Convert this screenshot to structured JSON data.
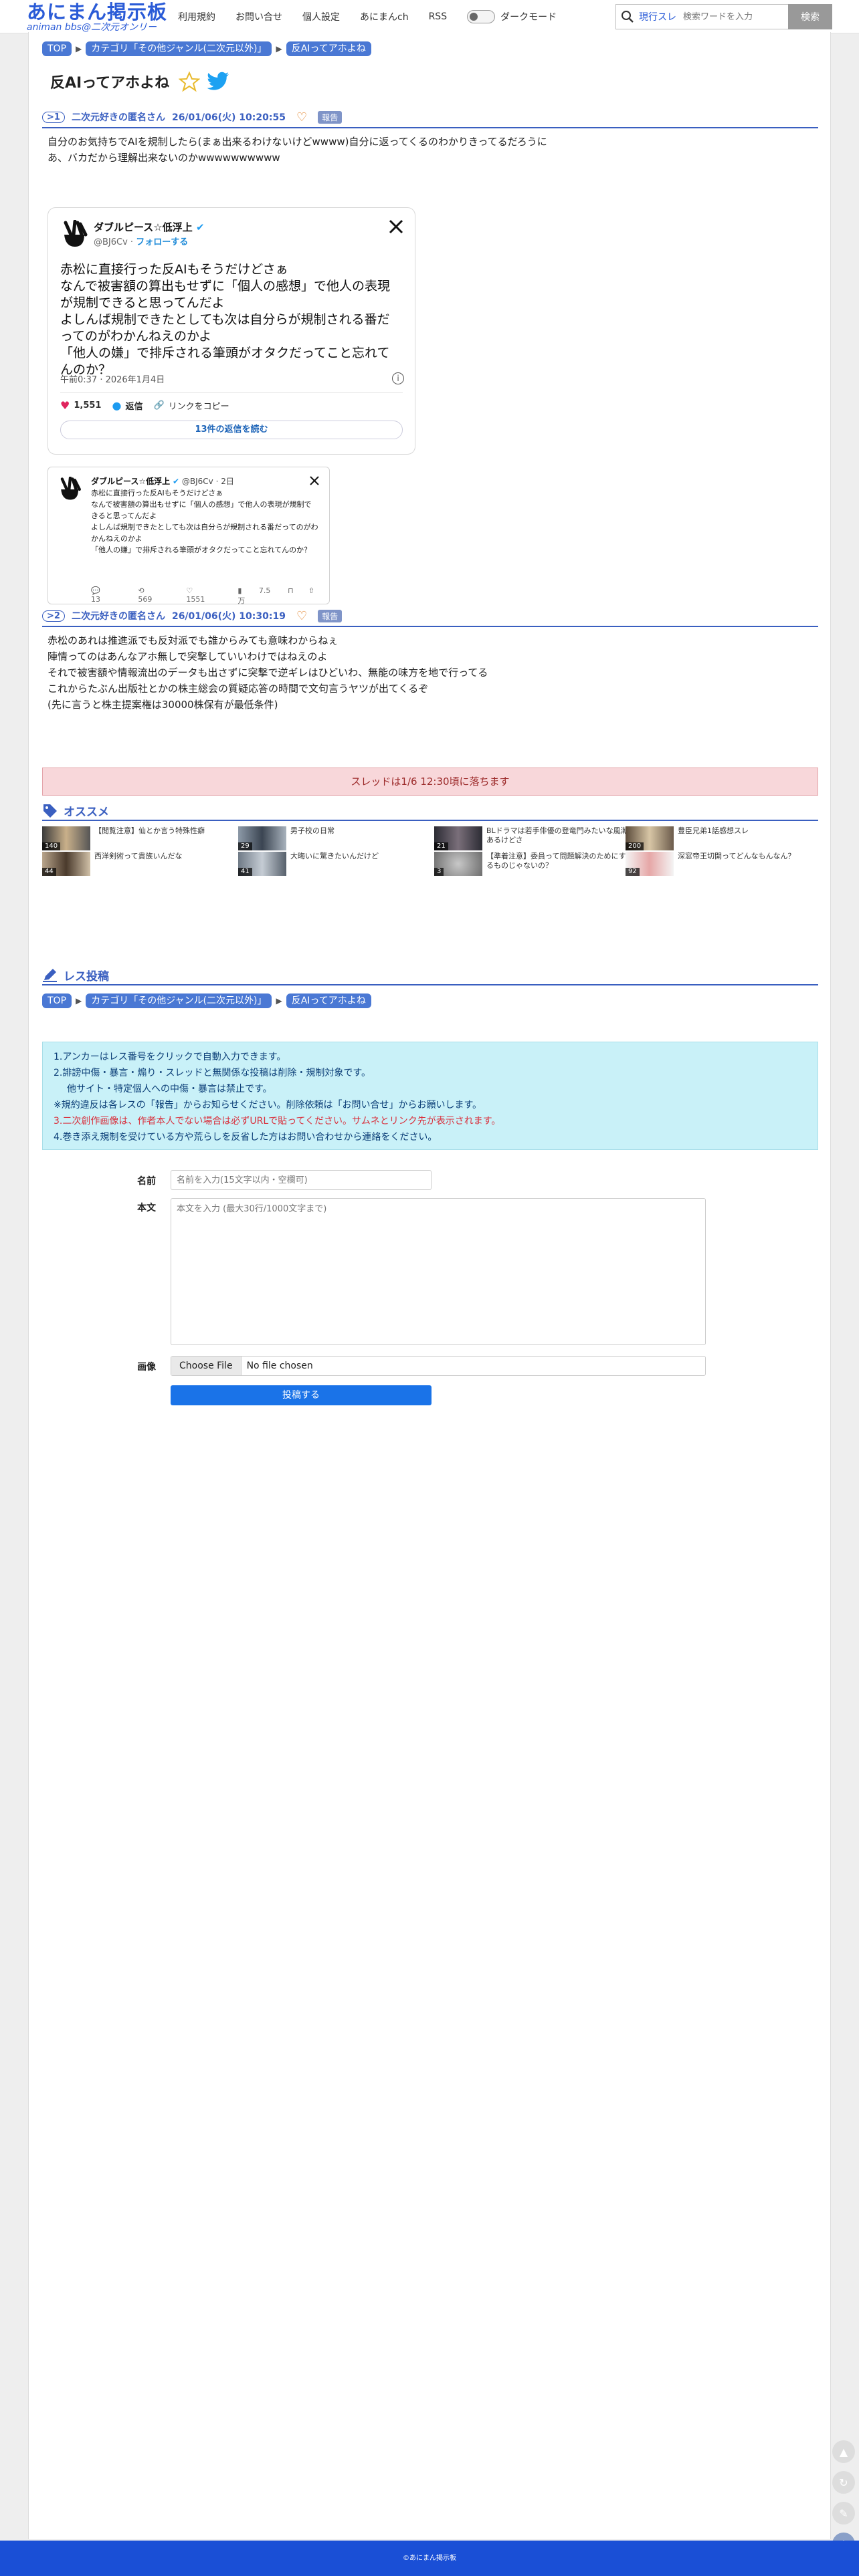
{
  "header": {
    "logo": "あにまん掲示板",
    "logo_sub": "animan bbs@二次元オンリー",
    "nav": [
      "利用規約",
      "お問い合せ",
      "個人設定",
      "あにまんch",
      "RSS"
    ],
    "dark_mode": "ダークモード",
    "search_link": "現行スレ",
    "search_placeholder": "検索ワードを入力",
    "search_button": "検索"
  },
  "breadcrumb": {
    "top": "TOP",
    "category": "カテゴリ「その他ジャンル(二次元以外)」",
    "thread": "反AIってアホよね"
  },
  "thread_title": "反AIってアホよね",
  "posts": [
    {
      "num": ">1",
      "name": "二次元好きの匿名さん",
      "date": "26/01/06(火) 10:20:55",
      "report": "報告",
      "body": [
        "自分のお気持ちでAIを規制したら(まぁ出来るわけないけどwwww)自分に返ってくるのわかりきってるだろうに",
        "あ、バカだから理解出来ないのかwwwwwwwwww"
      ]
    },
    {
      "num": ">2",
      "name": "二次元好きの匿名さん",
      "date": "26/01/06(火) 10:30:19",
      "report": "報告",
      "body": [
        "赤松のあれは推進派でも反対派でも誰からみても意味わからねぇ",
        "陣情ってのはあんなアホ無しで突撃していいわけではねえのよ",
        "それで被害額や情報流出のデータも出さずに突撃で逆ギレはひどいわ、無能の味方を地で行ってる",
        "これからたぶん出版社とかの株主総会の質疑応答の時間で文句言うヤツが出てくるぞ",
        "(先に言うと株主提案権は30000株保有が最低条件)"
      ]
    }
  ],
  "tweet": {
    "name": "ダブルピース☆低浮上",
    "handle": "@BJ6Cv",
    "follow": "フォローする",
    "text": [
      "赤松に直接行った反AIもそうだけどさぁ",
      "なんで被害額の算出もせずに「個人の感想」で他人の表現が規制できると思ってんだよ",
      "よしんば規制できたとしても次は自分らが規制される番だってのがわかんねえのかよ",
      "「他人の嫌」で排斥される筆頭がオタクだってこと忘れてんのか？"
    ],
    "time": "午前0:37 · 2026年1月4日",
    "likes": "1,551",
    "reply": "返信",
    "copy": "リンクをコピー",
    "replies_link": "13件の返信を読む"
  },
  "quote": {
    "name": "ダブルピース☆低浮上",
    "handle": "@BJ6Cv · 2日",
    "text": [
      "赤松に直接行った反AIもそうだけどさぁ",
      "なんで被害額の算出もせずに「個人の感想」で他人の表現が規制できると思ってんだよ",
      "よしんば規制できたとしても次は自分らが規制される番だってのがわかんねえのかよ",
      "「他人の嫌」で排斥される筆頭がオタクだってこと忘れてんのか？"
    ],
    "replies": "13",
    "retweets": "569",
    "likes": "1551",
    "views": "7.5万"
  },
  "notice": "スレッドは1/6 12:30頃に落ちます",
  "recommend_title": "オススメ",
  "recommend": [
    {
      "title": "【閲覧注意】仙とか言う特殊性癖",
      "count": "140"
    },
    {
      "title": "男子校の日常",
      "count": "29"
    },
    {
      "title": "BLドラマは若手俳優の登竜門みたいな風潮あるけどさ",
      "count": "21"
    },
    {
      "title": "豊臣兄弟1話感想スレ",
      "count": "200"
    },
    {
      "title": "西洋剣術って貴族いんだな",
      "count": "44"
    },
    {
      "title": "大晦いに驚きたいんだけど",
      "count": "41"
    },
    {
      "title": "【準着注意】委員って問題解決のためにするものじゃないの？",
      "count": "3"
    },
    {
      "title": "深窓帝王切開ってどんなもんなん？",
      "count": "92"
    }
  ],
  "form": {
    "title": "レス投稿",
    "rules": [
      "1.アンカーはレス番号をクリックで自動入力できます。",
      "2.誹謗中傷・暴言・煽り・スレッドと無関係な投稿は削除・規制対象です。",
      "他サイト・特定個人への中傷・暴言は禁止です。",
      "※規約違反は各レスの「報告」からお知らせください。削除依頼は「お問い合せ」からお願いします。",
      "3.二次創作画像は、作者本人でない場合は必ずURLで貼ってください。サムネとリンク先が表示されます。",
      "4.巻き添え規制を受けている方や荒らしを反省した方はお問い合わせから連絡をください。"
    ],
    "name_label": "名前",
    "name_placeholder": "名前を入力(15文字以内・空欄可)",
    "body_label": "本文",
    "body_placeholder": "本文を入力 (最大30行/1000文字まで)",
    "image_label": "画像",
    "file_button": "Choose File",
    "file_none": "No file chosen",
    "submit": "投稿する"
  },
  "footer": "©あにまん掲示板",
  "colors": {
    "accent": "#3a5fc0",
    "footer": "#1a4fd6",
    "notice_bg": "#f8d7da",
    "rules_bg": "#c9f1f8",
    "submit": "#1a73e8"
  }
}
